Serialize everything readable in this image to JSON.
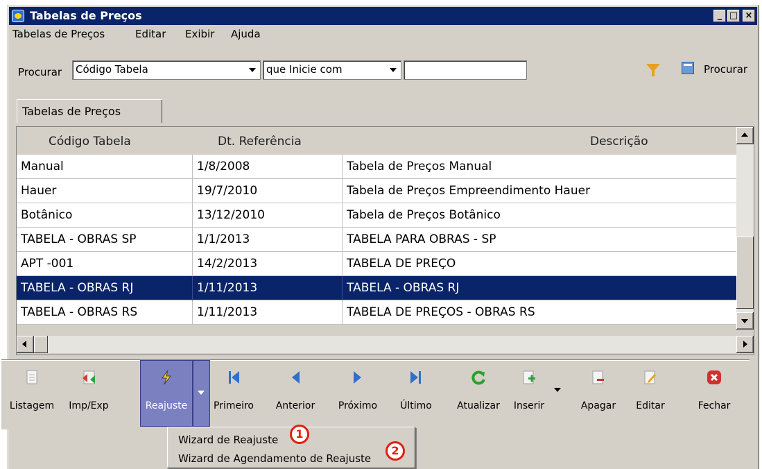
{
  "window": {
    "title": "Tabelas de Preços"
  },
  "menubar": [
    "Tabelas de Preços",
    "Editar",
    "Exibir",
    "Ajuda"
  ],
  "search": {
    "label": "Procurar",
    "field_value": "Código Tabela",
    "condition_value": "que Inicie com",
    "text_value": "",
    "button_label": "Procurar"
  },
  "tab": {
    "label": "Tabelas de Preços"
  },
  "grid": {
    "columns": [
      "Código Tabela",
      "Dt. Referência",
      "Descrição"
    ],
    "rows": [
      {
        "codigo": "Manual",
        "data": "1/8/2008",
        "descricao": "Tabela de Preços Manual"
      },
      {
        "codigo": "Hauer",
        "data": "19/7/2010",
        "descricao": "Tabela de Preços Empreendimento Hauer"
      },
      {
        "codigo": "Botânico",
        "data": "13/12/2010",
        "descricao": "Tabela de Preços Botânico"
      },
      {
        "codigo": "TABELA - OBRAS SP",
        "data": "1/1/2013",
        "descricao": "TABELA PARA OBRAS - SP"
      },
      {
        "codigo": "APT -001",
        "data": "14/2/2013",
        "descricao": "TABELA DE PREÇO"
      },
      {
        "codigo": "TABELA - OBRAS RJ",
        "data": "1/11/2013",
        "descricao": "TABELA - OBRAS RJ"
      },
      {
        "codigo": "TABELA - OBRAS RS",
        "data": "1/11/2013",
        "descricao": "TABELA DE PREÇOS - OBRAS RS"
      }
    ]
  },
  "toolbar": {
    "listagem": "Listagem",
    "impexp": "Imp/Exp",
    "reajuste": "Reajuste",
    "primeiro": "Primeiro",
    "anterior": "Anterior",
    "proximo": "Próximo",
    "ultimo": "Último",
    "atualizar": "Atualizar",
    "inserir": "Inserir",
    "apagar": "Apagar",
    "editar": "Editar",
    "fechar": "Fechar"
  },
  "dropdown": {
    "items": [
      "Wizard de Reajuste",
      "Wizard de Agendamento de Reajuste"
    ],
    "badges": [
      "1",
      "2"
    ]
  },
  "colors": {
    "titlebar": "#0a246a",
    "selection": "#0a246a",
    "active_button": "#7b80c0",
    "badge": "#e02010",
    "nav_icon": "#3070c8",
    "refresh_icon": "#2aa02a",
    "close_icon": "#d03030"
  }
}
